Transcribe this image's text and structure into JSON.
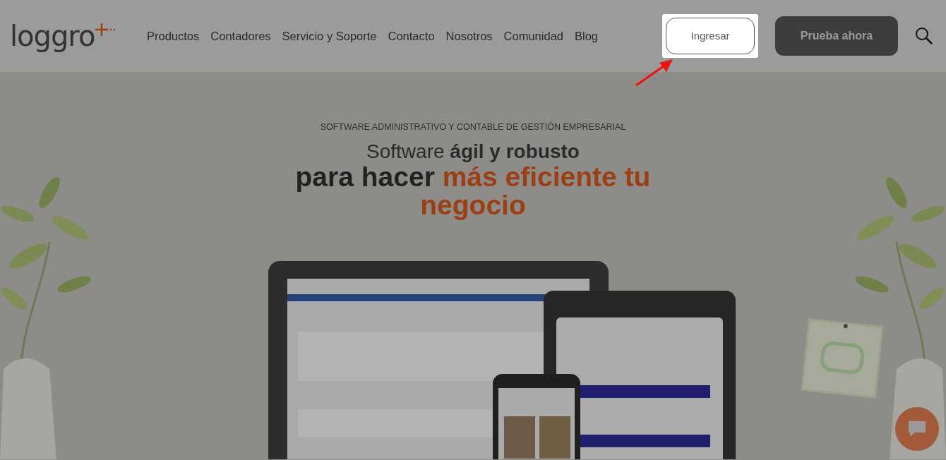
{
  "header": {
    "logo": "loggro",
    "nav_links": [
      "Productos",
      "Contadores",
      "Servicio y Soporte",
      "Contacto",
      "Nosotros",
      "Comunidad",
      "Blog"
    ],
    "login_button": {
      "label": "Ingresar",
      "highlighted": true
    },
    "trial_button": "Prueba ahora"
  },
  "hero": {
    "eyebrow": "SOFTWARE ADMINISTRATIVO Y CONTABLE DE GESTIÓN EMPRESARIAL",
    "title_line_1": "Software **ágil y robusto**",
    "title_line_2": [
      {
        "text": "para hacer ",
        "accent": false
      },
      {
        "text": "más eficiente tu negocio",
        "accent": true
      }
    ]
  }
}
